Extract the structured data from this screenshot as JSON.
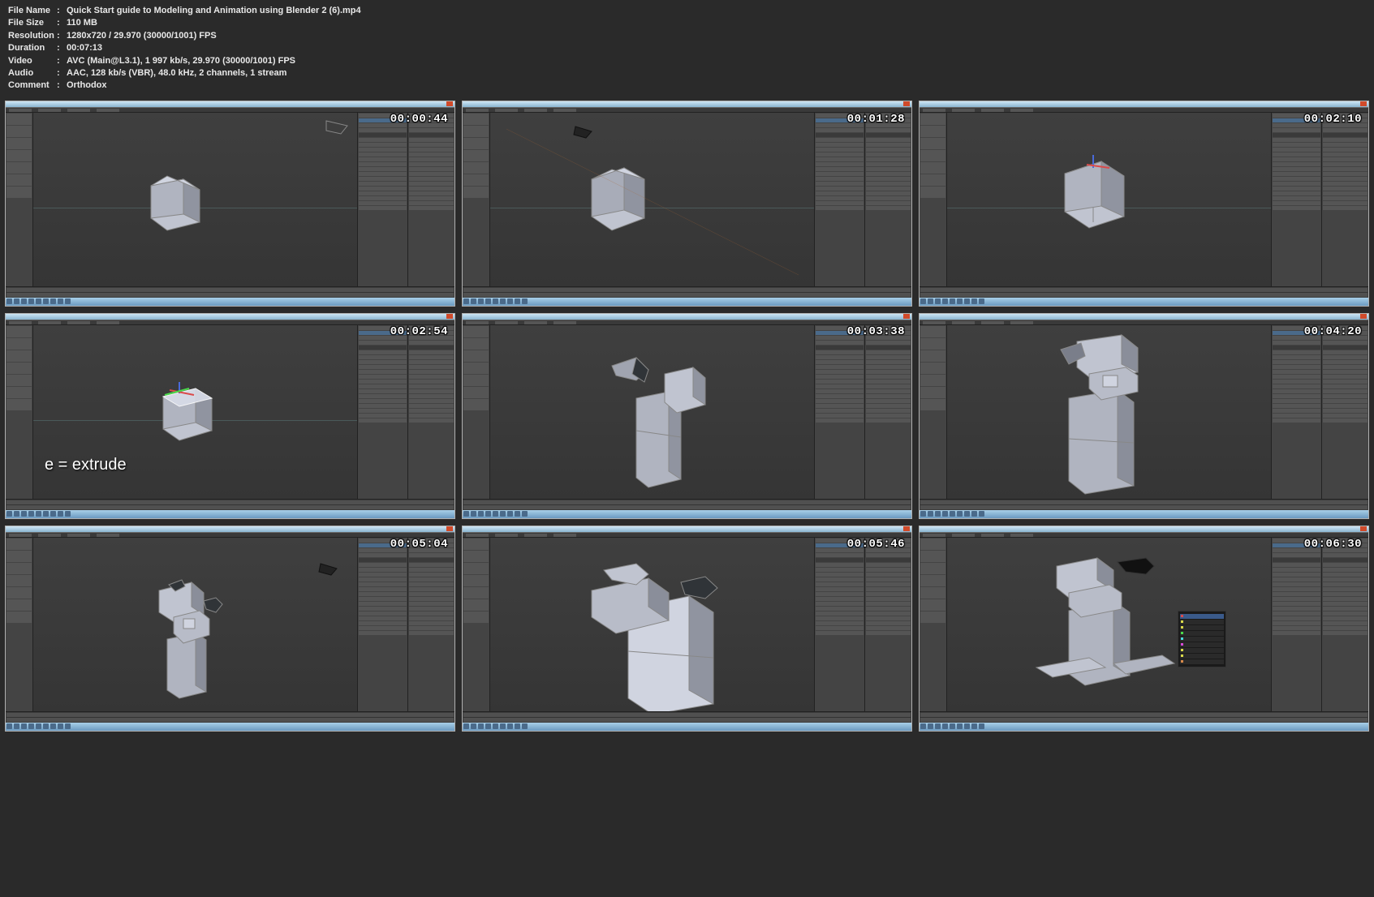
{
  "metadata": {
    "labels": {
      "file_name": "File Name",
      "file_size": "File Size",
      "resolution": "Resolution",
      "duration": "Duration",
      "video": "Video",
      "audio": "Audio",
      "comment": "Comment"
    },
    "file_name": "Quick Start guide to Modeling and Animation using Blender 2 (6).mp4",
    "file_size": "110 MB",
    "resolution": "1280x720 / 29.970 (30000/1001) FPS",
    "duration": "00:07:13",
    "video": "AVC (Main@L3.1), 1 997 kb/s, 29.970 (30000/1001) FPS",
    "audio": "AAC, 128 kb/s (VBR), 48.0 kHz, 2 channels, 1 stream",
    "comment": "Orthodox"
  },
  "thumbnails": [
    {
      "timestamp": "00:00:44",
      "annotation": "",
      "model": "cube1"
    },
    {
      "timestamp": "00:01:28",
      "annotation": "",
      "model": "cube2"
    },
    {
      "timestamp": "00:02:10",
      "annotation": "",
      "model": "cube3"
    },
    {
      "timestamp": "00:02:54",
      "annotation": "e = extrude",
      "model": "cube4"
    },
    {
      "timestamp": "00:03:38",
      "annotation": "",
      "model": "blocks1"
    },
    {
      "timestamp": "00:04:20",
      "annotation": "",
      "model": "blocks2"
    },
    {
      "timestamp": "00:05:04",
      "annotation": "",
      "model": "blocks3"
    },
    {
      "timestamp": "00:05:46",
      "annotation": "",
      "model": "blocks4"
    },
    {
      "timestamp": "00:06:30",
      "annotation": "",
      "model": "blocks5",
      "context_menu": true
    }
  ]
}
